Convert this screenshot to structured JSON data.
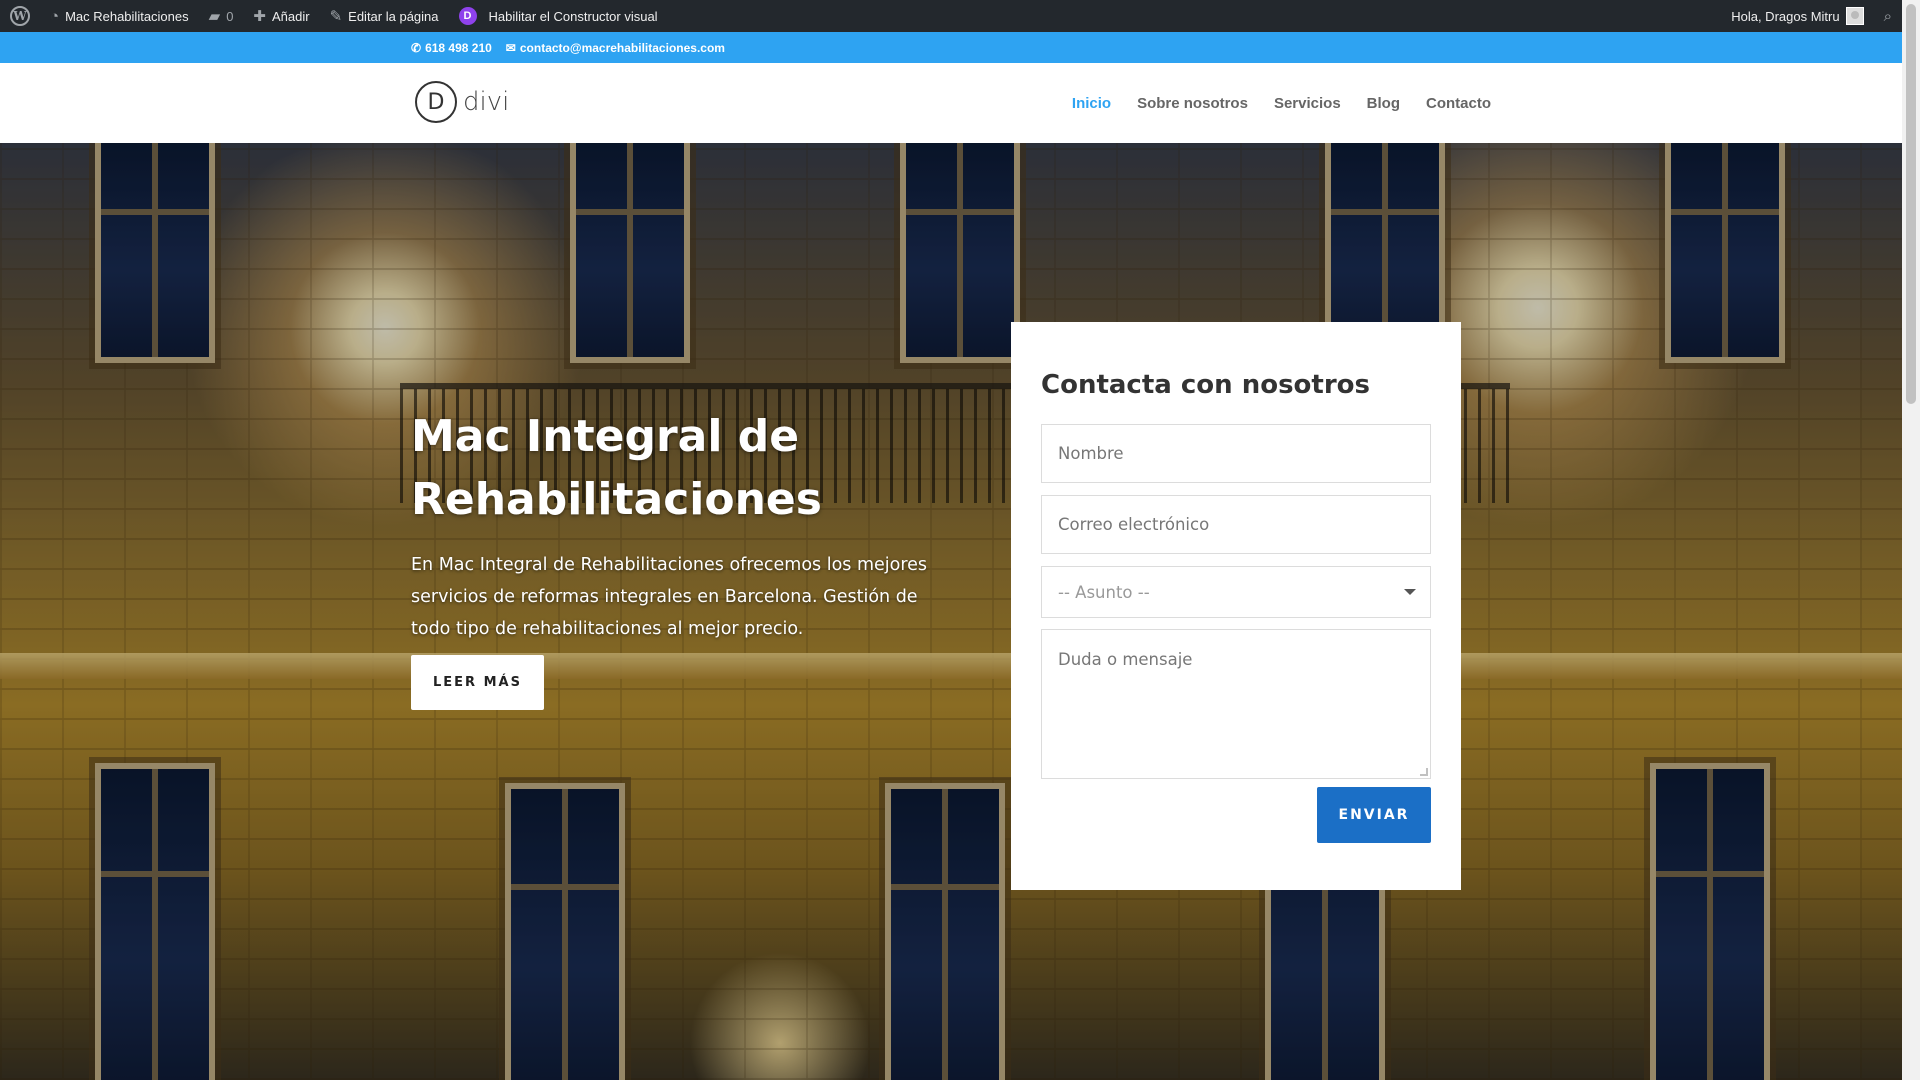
{
  "admin_bar": {
    "site_name": "Mac Rehabilitaciones",
    "comments_count": "0",
    "add_label": "Añadir",
    "edit_label": "Editar la página",
    "builder_label": "Habilitar el Constructor visual",
    "greeting": "Hola, Dragos Mitru"
  },
  "top_bar": {
    "phone": "618 498 210",
    "email": "contacto@macrehabilitaciones.com"
  },
  "header": {
    "logo_letter": "D",
    "logo_text": "divi",
    "nav": [
      {
        "label": "Inicio",
        "active": true
      },
      {
        "label": "Sobre nosotros",
        "active": false
      },
      {
        "label": "Servicios",
        "active": false
      },
      {
        "label": "Blog",
        "active": false
      },
      {
        "label": "Contacto",
        "active": false
      }
    ]
  },
  "hero": {
    "title_line1": "Mac Integral de",
    "title_line2": "Rehabilitaciones",
    "description": "En Mac Integral de Rehabilitaciones ofrecemos los mejores servicios de reformas integrales en Barcelona. Gestión de todo tipo de rehabilitaciones al mejor precio.",
    "button_label": "LEER MÁS"
  },
  "contact_form": {
    "title": "Contacta con nosotros",
    "name_placeholder": "Nombre",
    "email_placeholder": "Correo electrónico",
    "subject_selected": "-- Asunto --",
    "message_placeholder": "Duda o mensaje",
    "submit_label": "ENVIAR"
  },
  "colors": {
    "admin_bar": "#23282d",
    "top_bar": "#2ea3f2",
    "nav_active": "#2ea3f2",
    "submit_button": "#1b6fc6"
  },
  "icons": {
    "wordpress": "wordpress-logo-icon",
    "site": "dashboard-icon",
    "comments": "comment-bubble-icon",
    "add": "plus-icon",
    "edit": "pencil-icon",
    "divi": "divi-d-icon",
    "search": "search-icon",
    "phone": "phone-icon",
    "email": "envelope-icon"
  }
}
